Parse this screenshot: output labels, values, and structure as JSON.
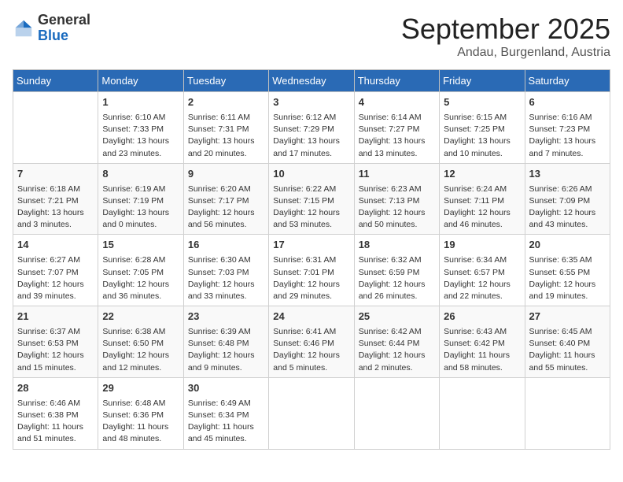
{
  "header": {
    "logo_general": "General",
    "logo_blue": "Blue",
    "month": "September 2025",
    "location": "Andau, Burgenland, Austria"
  },
  "days_of_week": [
    "Sunday",
    "Monday",
    "Tuesday",
    "Wednesday",
    "Thursday",
    "Friday",
    "Saturday"
  ],
  "weeks": [
    [
      {
        "day": "",
        "info": ""
      },
      {
        "day": "1",
        "info": "Sunrise: 6:10 AM\nSunset: 7:33 PM\nDaylight: 13 hours\nand 23 minutes."
      },
      {
        "day": "2",
        "info": "Sunrise: 6:11 AM\nSunset: 7:31 PM\nDaylight: 13 hours\nand 20 minutes."
      },
      {
        "day": "3",
        "info": "Sunrise: 6:12 AM\nSunset: 7:29 PM\nDaylight: 13 hours\nand 17 minutes."
      },
      {
        "day": "4",
        "info": "Sunrise: 6:14 AM\nSunset: 7:27 PM\nDaylight: 13 hours\nand 13 minutes."
      },
      {
        "day": "5",
        "info": "Sunrise: 6:15 AM\nSunset: 7:25 PM\nDaylight: 13 hours\nand 10 minutes."
      },
      {
        "day": "6",
        "info": "Sunrise: 6:16 AM\nSunset: 7:23 PM\nDaylight: 13 hours\nand 7 minutes."
      }
    ],
    [
      {
        "day": "7",
        "info": "Sunrise: 6:18 AM\nSunset: 7:21 PM\nDaylight: 13 hours\nand 3 minutes."
      },
      {
        "day": "8",
        "info": "Sunrise: 6:19 AM\nSunset: 7:19 PM\nDaylight: 13 hours\nand 0 minutes."
      },
      {
        "day": "9",
        "info": "Sunrise: 6:20 AM\nSunset: 7:17 PM\nDaylight: 12 hours\nand 56 minutes."
      },
      {
        "day": "10",
        "info": "Sunrise: 6:22 AM\nSunset: 7:15 PM\nDaylight: 12 hours\nand 53 minutes."
      },
      {
        "day": "11",
        "info": "Sunrise: 6:23 AM\nSunset: 7:13 PM\nDaylight: 12 hours\nand 50 minutes."
      },
      {
        "day": "12",
        "info": "Sunrise: 6:24 AM\nSunset: 7:11 PM\nDaylight: 12 hours\nand 46 minutes."
      },
      {
        "day": "13",
        "info": "Sunrise: 6:26 AM\nSunset: 7:09 PM\nDaylight: 12 hours\nand 43 minutes."
      }
    ],
    [
      {
        "day": "14",
        "info": "Sunrise: 6:27 AM\nSunset: 7:07 PM\nDaylight: 12 hours\nand 39 minutes."
      },
      {
        "day": "15",
        "info": "Sunrise: 6:28 AM\nSunset: 7:05 PM\nDaylight: 12 hours\nand 36 minutes."
      },
      {
        "day": "16",
        "info": "Sunrise: 6:30 AM\nSunset: 7:03 PM\nDaylight: 12 hours\nand 33 minutes."
      },
      {
        "day": "17",
        "info": "Sunrise: 6:31 AM\nSunset: 7:01 PM\nDaylight: 12 hours\nand 29 minutes."
      },
      {
        "day": "18",
        "info": "Sunrise: 6:32 AM\nSunset: 6:59 PM\nDaylight: 12 hours\nand 26 minutes."
      },
      {
        "day": "19",
        "info": "Sunrise: 6:34 AM\nSunset: 6:57 PM\nDaylight: 12 hours\nand 22 minutes."
      },
      {
        "day": "20",
        "info": "Sunrise: 6:35 AM\nSunset: 6:55 PM\nDaylight: 12 hours\nand 19 minutes."
      }
    ],
    [
      {
        "day": "21",
        "info": "Sunrise: 6:37 AM\nSunset: 6:53 PM\nDaylight: 12 hours\nand 15 minutes."
      },
      {
        "day": "22",
        "info": "Sunrise: 6:38 AM\nSunset: 6:50 PM\nDaylight: 12 hours\nand 12 minutes."
      },
      {
        "day": "23",
        "info": "Sunrise: 6:39 AM\nSunset: 6:48 PM\nDaylight: 12 hours\nand 9 minutes."
      },
      {
        "day": "24",
        "info": "Sunrise: 6:41 AM\nSunset: 6:46 PM\nDaylight: 12 hours\nand 5 minutes."
      },
      {
        "day": "25",
        "info": "Sunrise: 6:42 AM\nSunset: 6:44 PM\nDaylight: 12 hours\nand 2 minutes."
      },
      {
        "day": "26",
        "info": "Sunrise: 6:43 AM\nSunset: 6:42 PM\nDaylight: 11 hours\nand 58 minutes."
      },
      {
        "day": "27",
        "info": "Sunrise: 6:45 AM\nSunset: 6:40 PM\nDaylight: 11 hours\nand 55 minutes."
      }
    ],
    [
      {
        "day": "28",
        "info": "Sunrise: 6:46 AM\nSunset: 6:38 PM\nDaylight: 11 hours\nand 51 minutes."
      },
      {
        "day": "29",
        "info": "Sunrise: 6:48 AM\nSunset: 6:36 PM\nDaylight: 11 hours\nand 48 minutes."
      },
      {
        "day": "30",
        "info": "Sunrise: 6:49 AM\nSunset: 6:34 PM\nDaylight: 11 hours\nand 45 minutes."
      },
      {
        "day": "",
        "info": ""
      },
      {
        "day": "",
        "info": ""
      },
      {
        "day": "",
        "info": ""
      },
      {
        "day": "",
        "info": ""
      }
    ]
  ]
}
